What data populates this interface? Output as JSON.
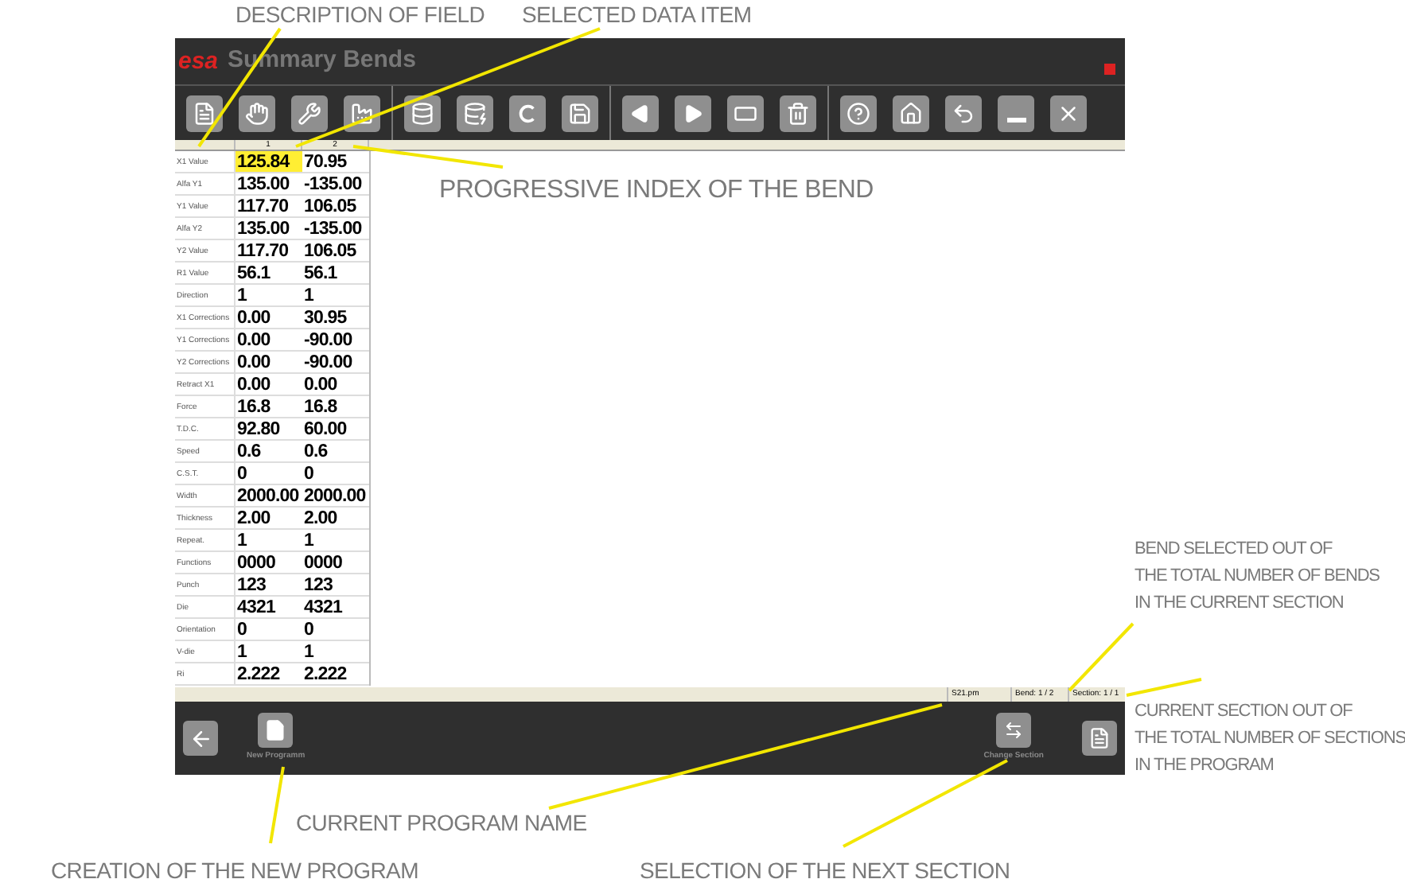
{
  "annotations": {
    "description_of_field": "DESCRIPTION OF FIELD",
    "selected_data_item": "SELECTED DATA ITEM",
    "progressive_index": "PROGRESSIVE INDEX OF THE BEND",
    "bend_selected": [
      "BEND SELECTED OUT OF",
      "THE TOTAL NUMBER OF BENDS",
      "IN THE CURRENT SECTION"
    ],
    "current_section": [
      "CURRENT SECTION OUT OF",
      "THE TOTAL NUMBER OF SECTIONS",
      "IN THE PROGRAM"
    ],
    "current_program_name": "CURRENT PROGRAM NAME",
    "creation_new_program": "CREATION OF THE NEW PROGRAM",
    "selection_next_section": "SELECTION OF THE NEXT SECTION"
  },
  "window": {
    "logo": "esa",
    "title": "Summary Bends"
  },
  "table": {
    "columns": [
      "1",
      "2"
    ],
    "rows": [
      {
        "label": "X1 Value",
        "cells": [
          {
            "text": "125.84",
            "selected": true
          },
          {
            "text": "70.95",
            "selected": false
          }
        ]
      },
      {
        "label": "Alfa Y1",
        "cells": [
          {
            "text": "135.00",
            "selected": false
          },
          {
            "text": "-135.00",
            "selected": false
          }
        ]
      },
      {
        "label": "Y1 Value",
        "cells": [
          {
            "text": "117.70",
            "selected": false
          },
          {
            "text": "106.05",
            "selected": false
          }
        ]
      },
      {
        "label": "Alfa Y2",
        "cells": [
          {
            "text": "135.00",
            "selected": false
          },
          {
            "text": "-135.00",
            "selected": false
          }
        ]
      },
      {
        "label": "Y2 Value",
        "cells": [
          {
            "text": "117.70",
            "selected": false
          },
          {
            "text": "106.05",
            "selected": false
          }
        ]
      },
      {
        "label": "R1 Value",
        "cells": [
          {
            "text": "56.1",
            "selected": false
          },
          {
            "text": "56.1",
            "selected": false
          }
        ]
      },
      {
        "label": "Direction",
        "cells": [
          {
            "text": "1",
            "selected": false
          },
          {
            "text": "1",
            "selected": false
          }
        ]
      },
      {
        "label": "X1 Corrections",
        "cells": [
          {
            "text": "0.00",
            "selected": false
          },
          {
            "text": "30.95",
            "selected": false
          }
        ]
      },
      {
        "label": "Y1 Corrections",
        "cells": [
          {
            "text": "0.00",
            "selected": false
          },
          {
            "text": "-90.00",
            "selected": false
          }
        ]
      },
      {
        "label": "Y2 Corrections",
        "cells": [
          {
            "text": "0.00",
            "selected": false
          },
          {
            "text": "-90.00",
            "selected": false
          }
        ]
      },
      {
        "label": "Retract X1",
        "cells": [
          {
            "text": "0.00",
            "selected": false
          },
          {
            "text": "0.00",
            "selected": false
          }
        ]
      },
      {
        "label": "Force",
        "cells": [
          {
            "text": "16.8",
            "selected": false
          },
          {
            "text": "16.8",
            "selected": false
          }
        ]
      },
      {
        "label": "T.D.C.",
        "cells": [
          {
            "text": "92.80",
            "selected": false
          },
          {
            "text": "60.00",
            "selected": false
          }
        ]
      },
      {
        "label": "Speed",
        "cells": [
          {
            "text": "0.6",
            "selected": false
          },
          {
            "text": "0.6",
            "selected": false
          }
        ]
      },
      {
        "label": "C.S.T.",
        "cells": [
          {
            "text": "0",
            "selected": false
          },
          {
            "text": "0",
            "selected": false
          }
        ]
      },
      {
        "label": "Width",
        "cells": [
          {
            "text": "2000.00",
            "selected": false
          },
          {
            "text": "2000.00",
            "selected": false
          }
        ]
      },
      {
        "label": "Thickness",
        "cells": [
          {
            "text": "2.00",
            "selected": false
          },
          {
            "text": "2.00",
            "selected": false
          }
        ]
      },
      {
        "label": "Repeat.",
        "cells": [
          {
            "text": "1",
            "selected": false
          },
          {
            "text": "1",
            "selected": false
          }
        ]
      },
      {
        "label": "Functions",
        "cells": [
          {
            "text": "0000",
            "selected": false
          },
          {
            "text": "0000",
            "selected": false
          }
        ]
      },
      {
        "label": "Punch",
        "cells": [
          {
            "text": "123",
            "selected": false
          },
          {
            "text": "123",
            "selected": false
          }
        ]
      },
      {
        "label": "Die",
        "cells": [
          {
            "text": "4321",
            "selected": false
          },
          {
            "text": "4321",
            "selected": false
          }
        ]
      },
      {
        "label": "Orientation",
        "cells": [
          {
            "text": "0",
            "selected": false
          },
          {
            "text": "0",
            "selected": false
          }
        ]
      },
      {
        "label": "V-die",
        "cells": [
          {
            "text": "1",
            "selected": false
          },
          {
            "text": "1",
            "selected": false
          }
        ]
      },
      {
        "label": "Ri",
        "cells": [
          {
            "text": "2.222",
            "selected": false
          },
          {
            "text": "2.222",
            "selected": false
          }
        ]
      }
    ]
  },
  "status_bar": {
    "program": "S21.pm",
    "bend": "Bend: 1 / 2",
    "section": "Section: 1 / 1"
  },
  "bottom_bar": {
    "new_program": "New Programm",
    "change_section": "Change Section"
  }
}
